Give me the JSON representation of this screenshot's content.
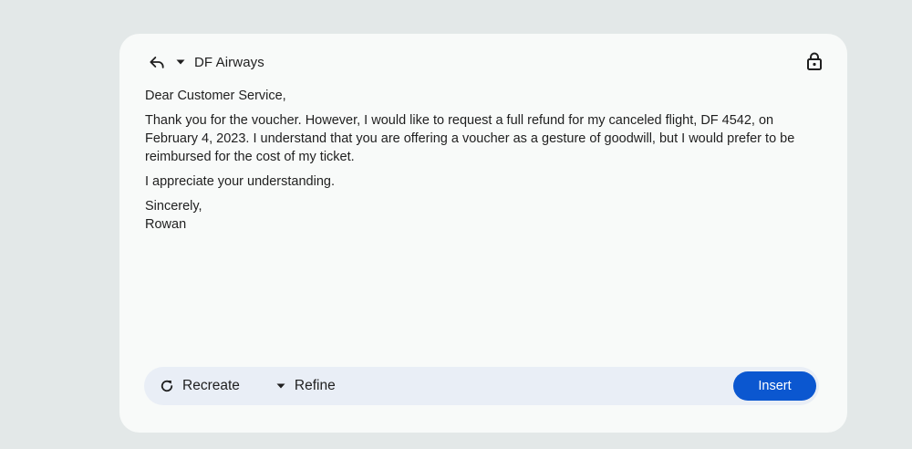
{
  "header": {
    "sender": "DF Airways",
    "reply_icon": "reply-icon",
    "dropdown_icon": "caret-down-icon",
    "lock_icon": "lock-icon"
  },
  "email": {
    "greeting": "Dear Customer Service,",
    "paragraph1": "Thank you for the voucher. However, I would like to request a full refund for my canceled flight, DF 4542, on February 4, 2023. I understand that you are offering a voucher as a gesture of goodwill, but I would prefer to be reimbursed for the cost of my ticket.",
    "paragraph2": "I appreciate your understanding.",
    "closing": "Sincerely,",
    "signature": "Rowan"
  },
  "actions": {
    "recreate_label": "Recreate",
    "recreate_icon": "refresh-icon",
    "refine_label": "Refine",
    "refine_icon": "caret-down-icon",
    "insert_label": "Insert"
  },
  "colors": {
    "accent": "#0b57d0",
    "card_bg": "#f8faf9",
    "page_bg": "#e3e8e8",
    "action_bar_bg": "#e9eef6"
  }
}
